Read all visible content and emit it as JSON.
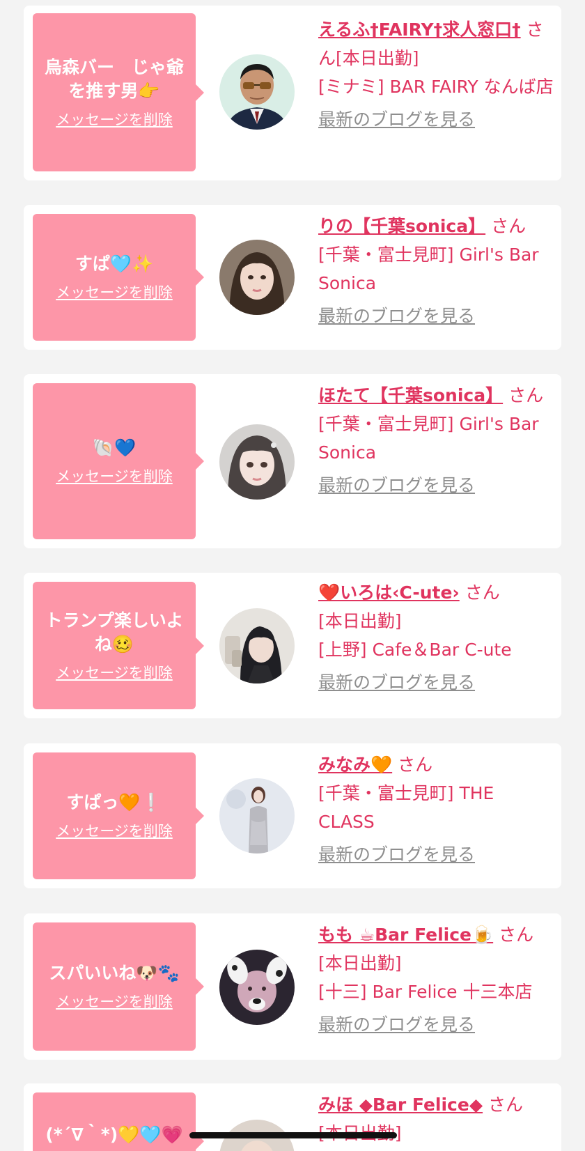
{
  "delete_label": "メッセージを削除",
  "blog_label": "最新のブログを見る",
  "san_label": "さん",
  "colors": {
    "bubble": "#fd96a8",
    "accent": "#e0345f",
    "link_gray": "#8e8e8e",
    "background": "#f3f3f3"
  },
  "messages": [
    {
      "message": "烏森バー　じゃ爺を推す男👉",
      "name": "えるふ†FAIRY†求人窓口†",
      "status": "[本日出勤]",
      "shop": "[ミナミ] BAR FAIRY なんば店",
      "avatar_icon": "man-in-suit-avatar"
    },
    {
      "message": "すぱ🩵✨",
      "name": "りの【千葉sonica】",
      "status": "",
      "shop": "[千葉・富士見町] Girl's Bar Sonica",
      "avatar_icon": "woman-selfie-avatar"
    },
    {
      "message": "🐚💙",
      "name": "ほたて【千葉sonica】",
      "status": "",
      "shop": "[千葉・富士見町] Girl's Bar Sonica",
      "avatar_icon": "woman-portrait-avatar"
    },
    {
      "message": "トランプ楽しいよね🥴",
      "name": "❤️いろは‹C-ute›",
      "status": "[本日出勤]",
      "shop": "[上野] Cafe＆Bar C-ute",
      "avatar_icon": "mirror-selfie-avatar"
    },
    {
      "message": "すぱっ🧡❕",
      "name": "みなみ🧡",
      "status": "",
      "shop": "[千葉・富士見町] THE CLASS",
      "avatar_icon": "woman-white-dress-avatar"
    },
    {
      "message": "スパいいね🐶🐾",
      "name": "もも ☕Bar Felice🍺",
      "status": "[本日出勤]",
      "shop": "[十三] Bar Felice 十三本店",
      "avatar_icon": "dog-filter-avatar"
    },
    {
      "message": "(*´∇｀*)💛🩵💗",
      "name": "みほ ◆Bar Felice◆",
      "status": "[本日出勤]",
      "shop": "",
      "avatar_icon": "woman-avatar"
    }
  ]
}
